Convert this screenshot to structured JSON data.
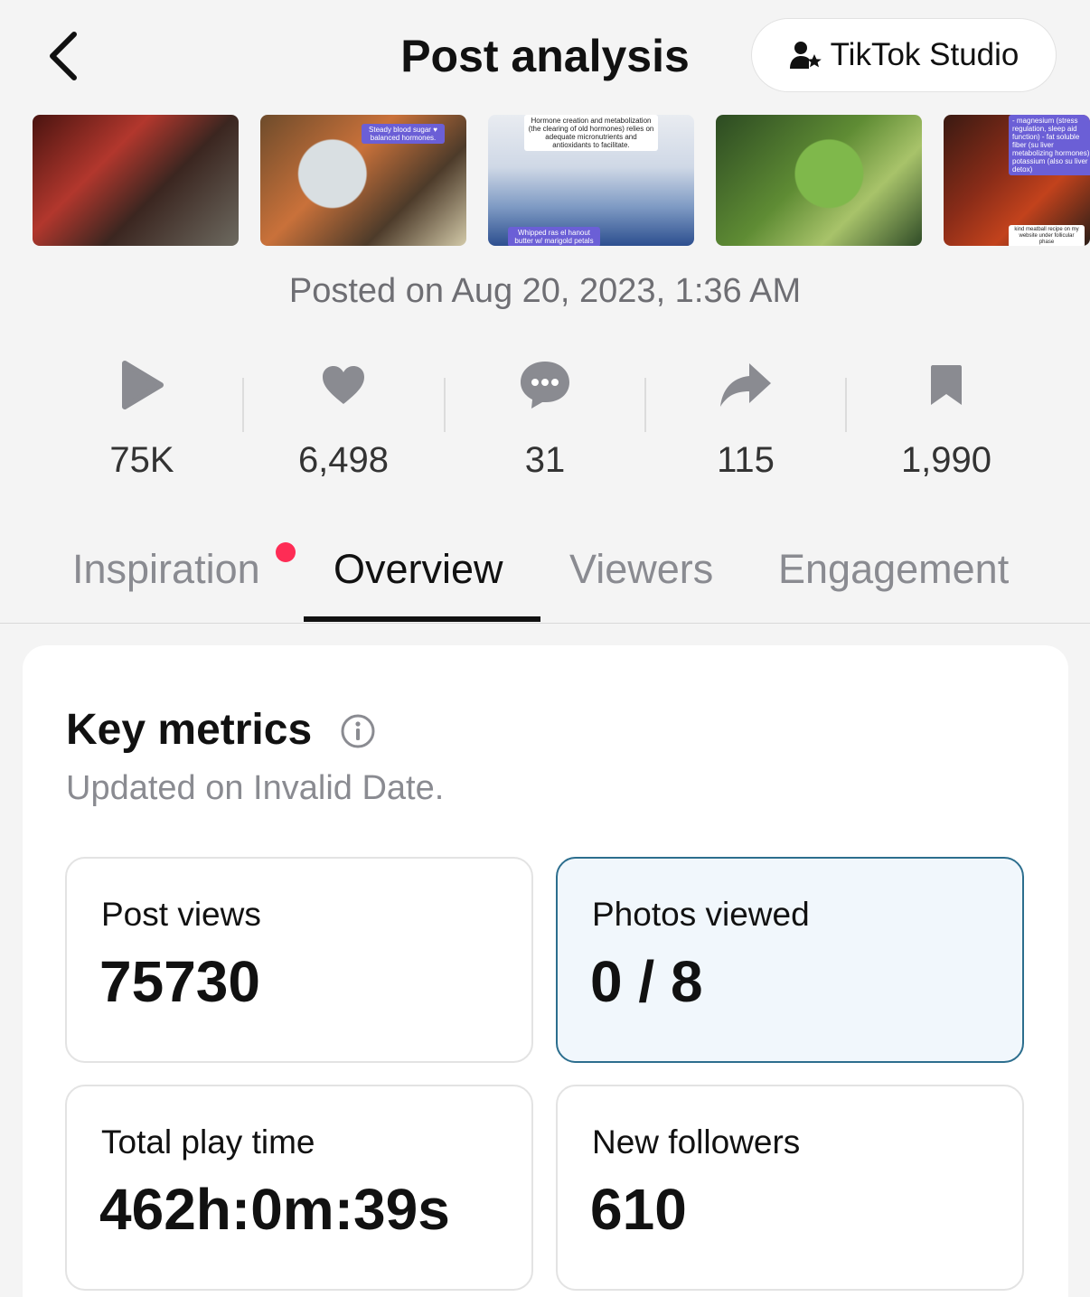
{
  "header": {
    "title": "Post analysis",
    "studio_button_label": "TikTok Studio"
  },
  "thumbnails": [
    {
      "caption": "",
      "caption2": ""
    },
    {
      "caption": "Steady blood sugar ♥ balanced hormones.",
      "caption2": ""
    },
    {
      "caption": "Hormone creation and metabolization (the clearing of old hormones) relies on adequate micronutrients and antioxidants to facilitate.",
      "caption2": "Whipped ras el hanout butter w/ marigold petals"
    },
    {
      "caption": "",
      "caption2": ""
    },
    {
      "caption": "- magnesium (stress regulation, sleep aid function) - fat soluble fiber (su liver metabolizing hormones) - potassium (also su liver detox)",
      "caption2": "kind meatball recipe on my website under follicular phase"
    }
  ],
  "posted": "Posted on Aug 20, 2023, 1:36 AM",
  "stats": {
    "views": "75K",
    "likes": "6,498",
    "comments": "31",
    "shares": "115",
    "saves": "1,990"
  },
  "tabs": [
    {
      "label": "Inspiration"
    },
    {
      "label": "Overview"
    },
    {
      "label": "Viewers"
    },
    {
      "label": "Engagement"
    }
  ],
  "key_metrics": {
    "title": "Key metrics",
    "subtitle": "Updated on Invalid Date.",
    "cards": [
      {
        "label": "Post views",
        "value": "75730"
      },
      {
        "label": "Photos viewed",
        "value": "0 / 8"
      },
      {
        "label": "Total play time",
        "value": "462h:0m:39s"
      },
      {
        "label": "New followers",
        "value": "610"
      }
    ]
  },
  "colors": {
    "accent_dot": "#fe2c55",
    "selected_border": "#2c6e8e",
    "selected_bg": "#f1f7fc",
    "icon_gray": "#8a8b91"
  }
}
